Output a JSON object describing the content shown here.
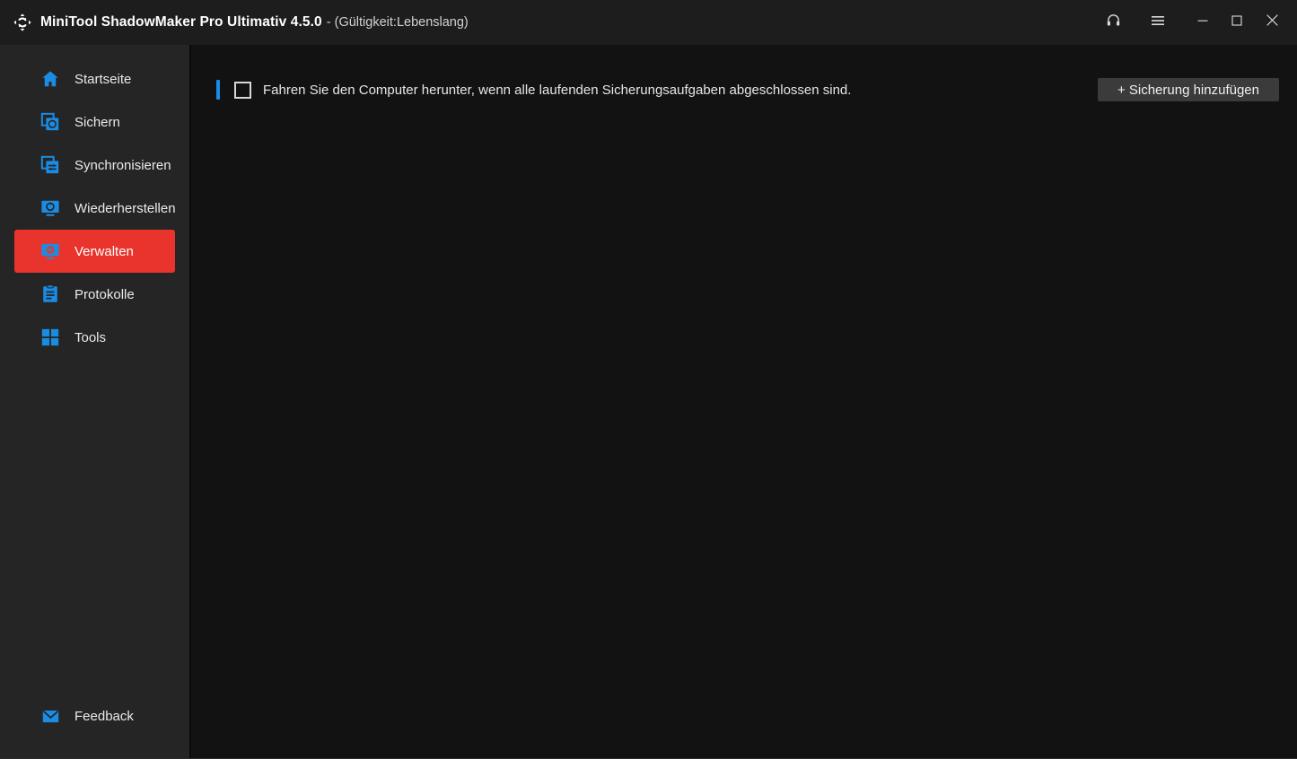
{
  "window": {
    "titlebar": {
      "logo_icon": "sync-arrows-icon",
      "app_title": "MiniTool ShadowMaker Pro Ultimativ 4.5.0",
      "license_text": "- (Gültigkeit:Lebenslang)",
      "controls": [
        {
          "name": "support-headset",
          "icon": "headset-icon"
        },
        {
          "name": "menu",
          "icon": "hamburger-menu-icon"
        },
        {
          "name": "minimize",
          "icon": "minimize-icon"
        },
        {
          "name": "maximize",
          "icon": "maximize-icon"
        },
        {
          "name": "close",
          "icon": "close-icon"
        }
      ]
    },
    "sidebar": {
      "items": [
        {
          "label": "Startseite",
          "icon": "home-icon",
          "active": false
        },
        {
          "label": "Sichern",
          "icon": "backup-icon",
          "active": false
        },
        {
          "label": "Synchronisieren",
          "icon": "sync-icon",
          "active": false
        },
        {
          "label": "Wiederherstellen",
          "icon": "restore-monitor-icon",
          "active": false
        },
        {
          "label": "Verwalten",
          "icon": "manage-gear-monitor-icon",
          "active": true
        },
        {
          "label": "Protokolle",
          "icon": "clipboard-log-icon",
          "active": false
        },
        {
          "label": "Tools",
          "icon": "grid-squares-icon",
          "active": false
        }
      ],
      "feedback": {
        "label": "Feedback",
        "icon": "mail-envelope-icon"
      }
    },
    "main": {
      "shutdown_checkbox": {
        "label": "Fahren Sie den Computer herunter, wenn alle laufenden Sicherungsaufgaben abgeschlossen sind.",
        "checked": false
      },
      "add_backup_button": "+ Sicherung hinzufügen"
    },
    "colors": {
      "accent_red": "#e8342c",
      "accent_blue": "#1b8ce3",
      "titlebar_bg": "#1d1d1d",
      "sidebar_bg": "#252525",
      "content_bg": "#121212",
      "button_bg": "#3b3b3b"
    }
  }
}
